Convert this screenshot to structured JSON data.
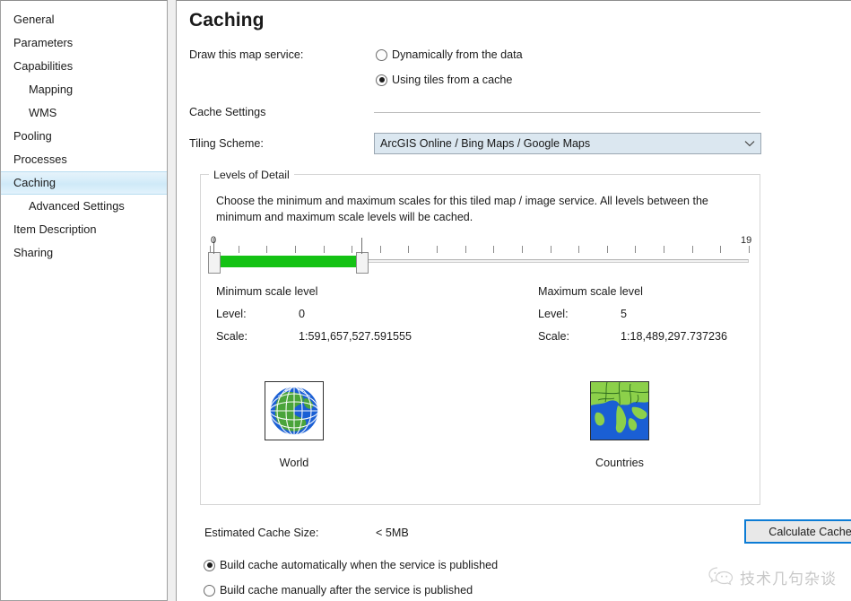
{
  "sidebar": {
    "items": [
      {
        "label": "General",
        "indent": false,
        "selected": false
      },
      {
        "label": "Parameters",
        "indent": false,
        "selected": false
      },
      {
        "label": "Capabilities",
        "indent": false,
        "selected": false
      },
      {
        "label": "Mapping",
        "indent": true,
        "selected": false
      },
      {
        "label": "WMS",
        "indent": true,
        "selected": false
      },
      {
        "label": "Pooling",
        "indent": false,
        "selected": false
      },
      {
        "label": "Processes",
        "indent": false,
        "selected": false
      },
      {
        "label": "Caching",
        "indent": false,
        "selected": true
      },
      {
        "label": "Advanced Settings",
        "indent": true,
        "selected": false
      },
      {
        "label": "Item Description",
        "indent": false,
        "selected": false
      },
      {
        "label": "Sharing",
        "indent": false,
        "selected": false
      }
    ]
  },
  "page": {
    "title": "Caching"
  },
  "draw_service": {
    "label": "Draw this map service:",
    "options": [
      {
        "label": "Dynamically from the data",
        "checked": false
      },
      {
        "label": "Using tiles from a cache",
        "checked": true
      }
    ]
  },
  "cache_settings": {
    "heading": "Cache Settings",
    "tiling_scheme_label": "Tiling Scheme:",
    "tiling_scheme_value": "ArcGIS Online / Bing Maps / Google Maps",
    "dropdown_icon": "chevron-down-icon"
  },
  "levels_of_detail": {
    "legend": "Levels of Detail",
    "description": "Choose the minimum and maximum scales for this tiled map / image service. All levels between the minimum and maximum scale levels will be cached.",
    "slider": {
      "min_tick_label": "0",
      "max_tick_label": "19",
      "range_min": 0,
      "range_max": 19,
      "value_min": 0,
      "value_max": 5,
      "fill_color": "#14c214",
      "tick_count": 20
    },
    "minimum": {
      "heading": "Minimum scale level",
      "level_label": "Level:",
      "level_value": "0",
      "scale_label": "Scale:",
      "scale_value": "1:591,657,527.591555",
      "thumb_icon": "globe-world-icon",
      "caption": "World"
    },
    "maximum": {
      "heading": "Maximum scale level",
      "level_label": "Level:",
      "level_value": "5",
      "scale_label": "Scale:",
      "scale_value": "1:18,489,297.737236",
      "thumb_icon": "countries-map-icon",
      "caption": "Countries"
    }
  },
  "footer": {
    "estimated_label": "Estimated Cache Size:",
    "estimated_value": "< 5MB",
    "calculate_button": "Calculate Cache Size",
    "build_options": [
      {
        "label": "Build cache automatically when the service is published",
        "checked": true
      },
      {
        "label": "Build cache manually after the service is published",
        "checked": false
      }
    ]
  },
  "watermark": {
    "text": "技术几句杂谈",
    "icon": "wechat-chat-icon"
  },
  "colors": {
    "accent_blue": "#0c7cd5",
    "selection_blue": "#d4ecf9",
    "slider_green": "#14c214",
    "combo_fill": "#dbe7f0"
  }
}
